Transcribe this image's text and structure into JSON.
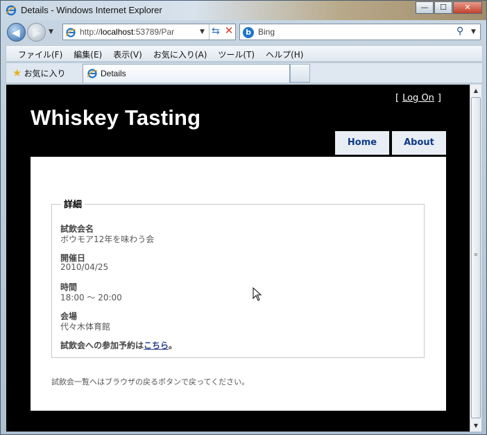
{
  "window": {
    "title": "Details - Windows Internet Explorer",
    "minimize_glyph": "—",
    "maximize_glyph": "☐",
    "close_glyph": "✕",
    "icon": "ie-icon"
  },
  "navbar": {
    "address_prefix": "http://",
    "address_host": "localhost",
    "address_rest": ":53789/Par",
    "search_placeholder": "Bing",
    "back_icon": "back-arrow-icon",
    "forward_icon": "forward-arrow-icon"
  },
  "menubar": {
    "items": [
      "ファイル(F)",
      "編集(E)",
      "表示(V)",
      "お気に入り(A)",
      "ツール(T)",
      "ヘルプ(H)"
    ]
  },
  "tabbar": {
    "favorites_label": "お気に入り",
    "active_tab": "Details"
  },
  "site": {
    "login_open": "[",
    "login_link": "Log On",
    "login_close": "]",
    "title": "Whiskey Tasting",
    "nav": [
      "Home",
      "About"
    ]
  },
  "details": {
    "legend": "詳細",
    "fields": [
      {
        "label": "試飲会名",
        "value": "ボウモア12年を味わう会"
      },
      {
        "label": "開催日",
        "value": "2010/04/25"
      },
      {
        "label": "時間",
        "value": "18:00 ～  20:00"
      },
      {
        "label": "会場",
        "value": "代々木体育館"
      }
    ],
    "reservation_prefix": "試飲会への参加予約は",
    "reservation_link": "こちら",
    "reservation_suffix": "。",
    "back_note": "試飲会一覧へはブラウザの戻るボタンで戻ってください。"
  },
  "colors": {
    "page_background": "#000000",
    "nav_text": "#0f3a8c",
    "link": "#2a3f8e"
  }
}
